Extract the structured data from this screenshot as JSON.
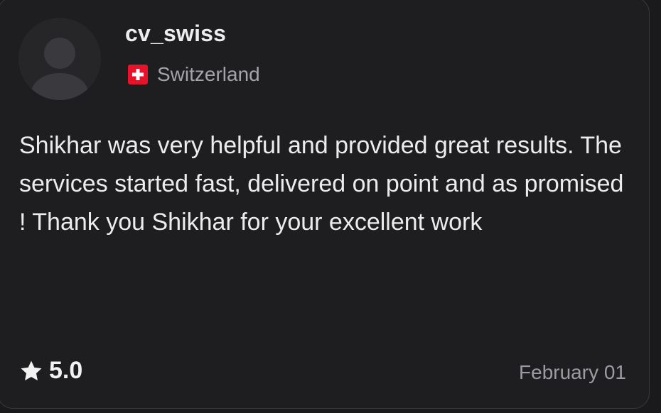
{
  "review": {
    "username": "cv_swiss",
    "country": "Switzerland",
    "country_flag_icon": "switzerland-flag-icon",
    "avatar_icon": "default-user-avatar-icon",
    "text": "Shikhar was very helpful and provided great results. The services started fast, delivered on point and as promised ! Thank you Shikhar for your excellent work",
    "rating": "5.0",
    "rating_icon": "star-icon",
    "date": "February 01"
  },
  "colors": {
    "background": "#1e1e21",
    "text_primary": "#ececec",
    "text_secondary": "#a4a4a8",
    "flag_red": "#e8132b"
  }
}
